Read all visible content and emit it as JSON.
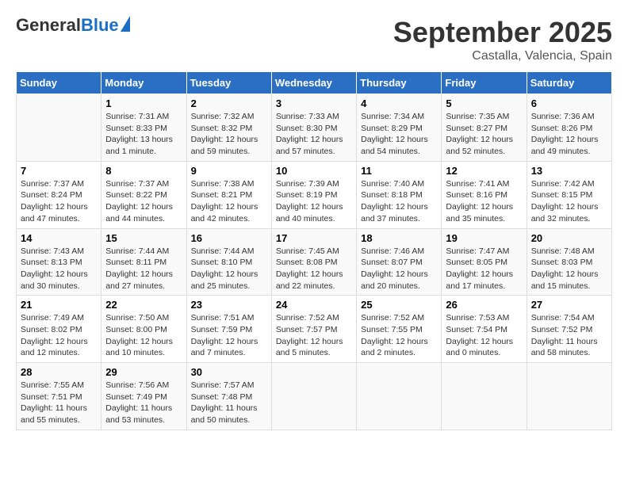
{
  "header": {
    "logo_general": "General",
    "logo_blue": "Blue",
    "month_title": "September 2025",
    "location": "Castalla, Valencia, Spain"
  },
  "days_of_week": [
    "Sunday",
    "Monday",
    "Tuesday",
    "Wednesday",
    "Thursday",
    "Friday",
    "Saturday"
  ],
  "weeks": [
    [
      {
        "day": "",
        "info": ""
      },
      {
        "day": "1",
        "info": "Sunrise: 7:31 AM\nSunset: 8:33 PM\nDaylight: 13 hours\nand 1 minute."
      },
      {
        "day": "2",
        "info": "Sunrise: 7:32 AM\nSunset: 8:32 PM\nDaylight: 12 hours\nand 59 minutes."
      },
      {
        "day": "3",
        "info": "Sunrise: 7:33 AM\nSunset: 8:30 PM\nDaylight: 12 hours\nand 57 minutes."
      },
      {
        "day": "4",
        "info": "Sunrise: 7:34 AM\nSunset: 8:29 PM\nDaylight: 12 hours\nand 54 minutes."
      },
      {
        "day": "5",
        "info": "Sunrise: 7:35 AM\nSunset: 8:27 PM\nDaylight: 12 hours\nand 52 minutes."
      },
      {
        "day": "6",
        "info": "Sunrise: 7:36 AM\nSunset: 8:26 PM\nDaylight: 12 hours\nand 49 minutes."
      }
    ],
    [
      {
        "day": "7",
        "info": "Sunrise: 7:37 AM\nSunset: 8:24 PM\nDaylight: 12 hours\nand 47 minutes."
      },
      {
        "day": "8",
        "info": "Sunrise: 7:37 AM\nSunset: 8:22 PM\nDaylight: 12 hours\nand 44 minutes."
      },
      {
        "day": "9",
        "info": "Sunrise: 7:38 AM\nSunset: 8:21 PM\nDaylight: 12 hours\nand 42 minutes."
      },
      {
        "day": "10",
        "info": "Sunrise: 7:39 AM\nSunset: 8:19 PM\nDaylight: 12 hours\nand 40 minutes."
      },
      {
        "day": "11",
        "info": "Sunrise: 7:40 AM\nSunset: 8:18 PM\nDaylight: 12 hours\nand 37 minutes."
      },
      {
        "day": "12",
        "info": "Sunrise: 7:41 AM\nSunset: 8:16 PM\nDaylight: 12 hours\nand 35 minutes."
      },
      {
        "day": "13",
        "info": "Sunrise: 7:42 AM\nSunset: 8:15 PM\nDaylight: 12 hours\nand 32 minutes."
      }
    ],
    [
      {
        "day": "14",
        "info": "Sunrise: 7:43 AM\nSunset: 8:13 PM\nDaylight: 12 hours\nand 30 minutes."
      },
      {
        "day": "15",
        "info": "Sunrise: 7:44 AM\nSunset: 8:11 PM\nDaylight: 12 hours\nand 27 minutes."
      },
      {
        "day": "16",
        "info": "Sunrise: 7:44 AM\nSunset: 8:10 PM\nDaylight: 12 hours\nand 25 minutes."
      },
      {
        "day": "17",
        "info": "Sunrise: 7:45 AM\nSunset: 8:08 PM\nDaylight: 12 hours\nand 22 minutes."
      },
      {
        "day": "18",
        "info": "Sunrise: 7:46 AM\nSunset: 8:07 PM\nDaylight: 12 hours\nand 20 minutes."
      },
      {
        "day": "19",
        "info": "Sunrise: 7:47 AM\nSunset: 8:05 PM\nDaylight: 12 hours\nand 17 minutes."
      },
      {
        "day": "20",
        "info": "Sunrise: 7:48 AM\nSunset: 8:03 PM\nDaylight: 12 hours\nand 15 minutes."
      }
    ],
    [
      {
        "day": "21",
        "info": "Sunrise: 7:49 AM\nSunset: 8:02 PM\nDaylight: 12 hours\nand 12 minutes."
      },
      {
        "day": "22",
        "info": "Sunrise: 7:50 AM\nSunset: 8:00 PM\nDaylight: 12 hours\nand 10 minutes."
      },
      {
        "day": "23",
        "info": "Sunrise: 7:51 AM\nSunset: 7:59 PM\nDaylight: 12 hours\nand 7 minutes."
      },
      {
        "day": "24",
        "info": "Sunrise: 7:52 AM\nSunset: 7:57 PM\nDaylight: 12 hours\nand 5 minutes."
      },
      {
        "day": "25",
        "info": "Sunrise: 7:52 AM\nSunset: 7:55 PM\nDaylight: 12 hours\nand 2 minutes."
      },
      {
        "day": "26",
        "info": "Sunrise: 7:53 AM\nSunset: 7:54 PM\nDaylight: 12 hours\nand 0 minutes."
      },
      {
        "day": "27",
        "info": "Sunrise: 7:54 AM\nSunset: 7:52 PM\nDaylight: 11 hours\nand 58 minutes."
      }
    ],
    [
      {
        "day": "28",
        "info": "Sunrise: 7:55 AM\nSunset: 7:51 PM\nDaylight: 11 hours\nand 55 minutes."
      },
      {
        "day": "29",
        "info": "Sunrise: 7:56 AM\nSunset: 7:49 PM\nDaylight: 11 hours\nand 53 minutes."
      },
      {
        "day": "30",
        "info": "Sunrise: 7:57 AM\nSunset: 7:48 PM\nDaylight: 11 hours\nand 50 minutes."
      },
      {
        "day": "",
        "info": ""
      },
      {
        "day": "",
        "info": ""
      },
      {
        "day": "",
        "info": ""
      },
      {
        "day": "",
        "info": ""
      }
    ]
  ]
}
